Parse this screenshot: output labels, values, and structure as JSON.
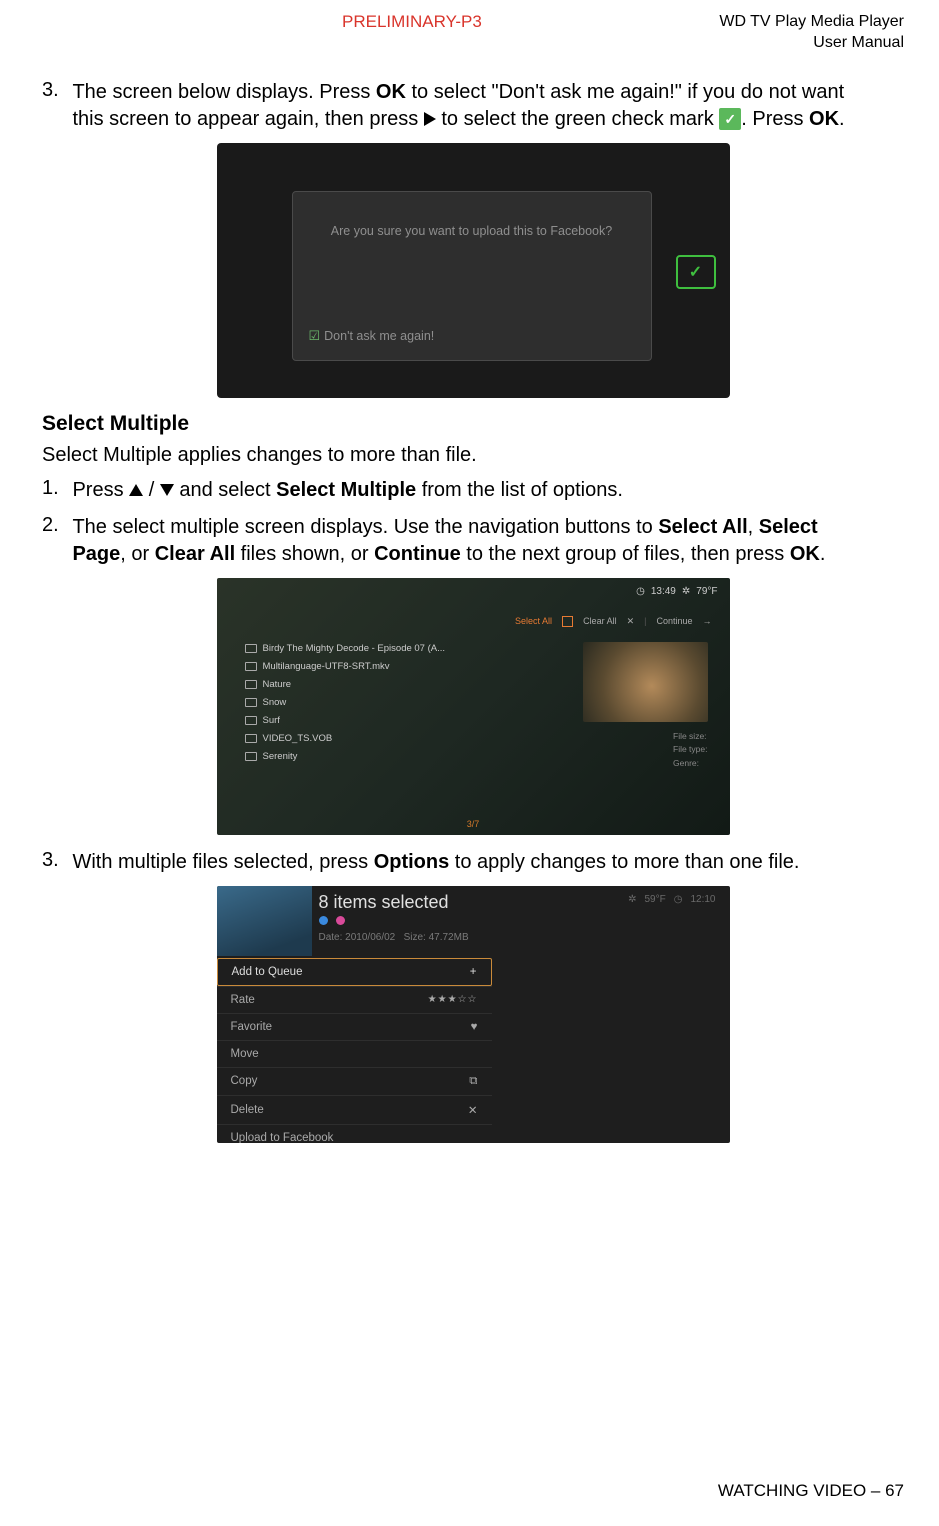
{
  "header": {
    "preliminary": "PRELIMINARY-P3",
    "product": "WD TV Play Media Player",
    "doc": "User Manual"
  },
  "step3top": {
    "num": "3.",
    "t1": "The screen below displays. Press ",
    "ok1": "OK",
    "t2": " to select \"Don't ask me again!\" if you do not want this screen to appear again, then press ",
    "t3": " to select the green check mark ",
    "t4": ". Press ",
    "ok2": "OK",
    "t5": "."
  },
  "shot1": {
    "q": "Are you sure you want to upload this to Facebook?",
    "chk": "Don't ask me again!"
  },
  "section": {
    "title": "Select Multiple",
    "intro": "Select Multiple applies changes to more than file."
  },
  "step1": {
    "num": "1.",
    "t1": "Press ",
    "t2": " / ",
    "t3": " and select ",
    "b1": "Select Multiple",
    "t4": " from the list of options."
  },
  "step2": {
    "num": "2.",
    "t1": "The select multiple screen displays. Use the navigation buttons to ",
    "b1": "Select All",
    "t2": ", ",
    "b2": "Select Page",
    "t3": ", or ",
    "b3": "Clear All",
    "t4": " files shown, or ",
    "b4": "Continue",
    "t5": " to the next group of files, then press ",
    "b5": "OK",
    "t6": "."
  },
  "shot2": {
    "time": "13:49",
    "temp": "79°F",
    "selectAll": "Select All",
    "clearAll": "Clear All",
    "continue": "Continue",
    "items": [
      "Birdy The Mighty Decode - Episode 07 (A...",
      "Multilanguage-UTF8-SRT.mkv",
      "Nature",
      "Snow",
      "Surf",
      "VIDEO_TS.VOB",
      "Serenity"
    ],
    "meta": {
      "fs": "File size:",
      "ft": "File type:",
      "gn": "Genre:"
    },
    "page": "3/7"
  },
  "step3b": {
    "num": "3.",
    "t1": "With multiple files selected, press ",
    "b1": "Options",
    "t2": " to apply changes to more than one file."
  },
  "shot3": {
    "title": "8 items selected",
    "date": "Date: 2010/06/02",
    "size": "Size: 47.72MB",
    "temp": "59°F",
    "time": "12:10",
    "menu": {
      "add": "Add to Queue",
      "rate": "Rate",
      "fav": "Favorite",
      "move": "Move",
      "copy": "Copy",
      "del": "Delete",
      "upload": "Upload to Facebook"
    }
  },
  "footer": "WATCHING VIDEO – 67"
}
